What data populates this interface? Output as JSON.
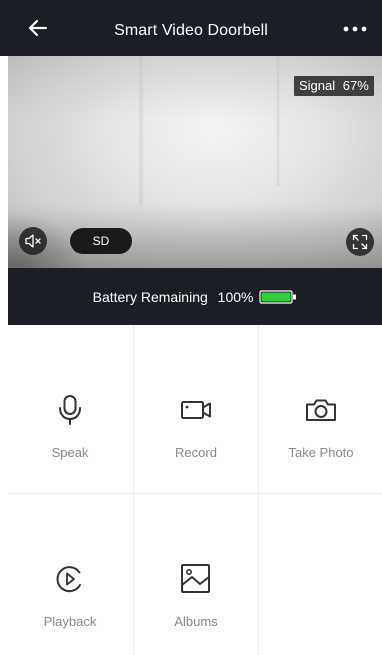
{
  "header": {
    "title": "Smart Video Doorbell"
  },
  "video": {
    "signal_label": "Signal",
    "signal_value": "67%",
    "quality_label": "SD"
  },
  "battery": {
    "label": "Battery Remaining",
    "value": "100%",
    "level": 1.0,
    "color": "#2fd23a"
  },
  "actions": [
    {
      "label": "Speak",
      "icon": "microphone-icon"
    },
    {
      "label": "Record",
      "icon": "video-camera-icon"
    },
    {
      "label": "Take Photo",
      "icon": "camera-icon"
    },
    {
      "label": "Playback",
      "icon": "playback-icon"
    },
    {
      "label": "Albums",
      "icon": "image-icon"
    }
  ]
}
